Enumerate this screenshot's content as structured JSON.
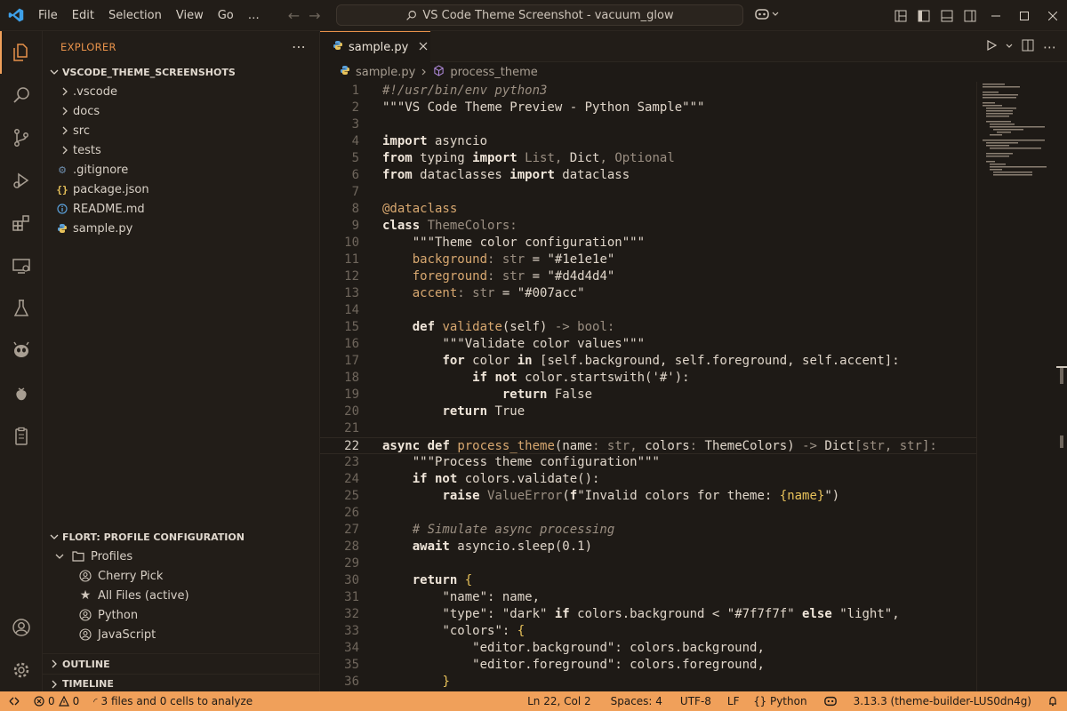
{
  "titlebar": {
    "menus": [
      "File",
      "Edit",
      "Selection",
      "View",
      "Go",
      "…"
    ],
    "search": "VS Code Theme Screenshot - vacuum_glow"
  },
  "sidebar": {
    "title": "EXPLORER",
    "workspace": "VSCODE_THEME_SCREENSHOTS",
    "folders": [
      ".vscode",
      "docs",
      "src",
      "tests"
    ],
    "files": [
      {
        "name": ".gitignore",
        "icon": "gear-file-icon"
      },
      {
        "name": "package.json",
        "icon": "json-icon"
      },
      {
        "name": "README.md",
        "icon": "info-icon"
      },
      {
        "name": "sample.py",
        "icon": "python-icon"
      }
    ],
    "profile_section": "FLORT: PROFILE CONFIGURATION",
    "profiles_label": "Profiles",
    "profiles": [
      {
        "name": "Cherry Pick",
        "icon": "account-icon"
      },
      {
        "name": "All Files (active)",
        "icon": "star-icon"
      },
      {
        "name": "Python",
        "icon": "account-icon"
      },
      {
        "name": "JavaScript",
        "icon": "account-icon"
      }
    ],
    "outline": "OUTLINE",
    "timeline": "TIMELINE"
  },
  "editor": {
    "tab": "sample.py",
    "breadcrumb_file": "sample.py",
    "breadcrumb_symbol": "process_theme",
    "current_line": 22,
    "lines": [
      [
        [
          "cm",
          "#!/usr/bin/env python3"
        ]
      ],
      [
        [
          "st",
          "\"\"\"VS Code Theme Preview - Python Sample\"\"\""
        ]
      ],
      [],
      [
        [
          "kw",
          "import"
        ],
        [
          "t",
          " asyncio"
        ]
      ],
      [
        [
          "kw",
          "from"
        ],
        [
          "t",
          " typing "
        ],
        [
          "kw",
          "import"
        ],
        [
          "ty",
          " List"
        ],
        [
          "op",
          ", "
        ],
        [
          "t",
          "Dict"
        ],
        [
          "op",
          ", "
        ],
        [
          "ty",
          "Optional"
        ]
      ],
      [
        [
          "kw",
          "from"
        ],
        [
          "t",
          " dataclasses "
        ],
        [
          "kw",
          "import"
        ],
        [
          "t",
          " dataclass"
        ]
      ],
      [],
      [
        [
          "fn",
          "@dataclass"
        ]
      ],
      [
        [
          "kw",
          "class"
        ],
        [
          "ty",
          " ThemeColors:"
        ]
      ],
      [
        [
          "t",
          "    "
        ],
        [
          "st",
          "\"\"\"Theme color configuration\"\"\""
        ]
      ],
      [
        [
          "t",
          "    "
        ],
        [
          "fn",
          "background"
        ],
        [
          "op",
          ": "
        ],
        [
          "ty",
          "str"
        ],
        [
          "t",
          " = "
        ],
        [
          "st",
          "\"#1e1e1e\""
        ]
      ],
      [
        [
          "t",
          "    "
        ],
        [
          "fn",
          "foreground"
        ],
        [
          "op",
          ": "
        ],
        [
          "ty",
          "str"
        ],
        [
          "t",
          " = "
        ],
        [
          "st",
          "\"#d4d4d4\""
        ]
      ],
      [
        [
          "t",
          "    "
        ],
        [
          "fn",
          "accent"
        ],
        [
          "op",
          ": "
        ],
        [
          "ty",
          "str"
        ],
        [
          "t",
          " = "
        ],
        [
          "st",
          "\"#007acc\""
        ]
      ],
      [],
      [
        [
          "t",
          "    "
        ],
        [
          "kw",
          "def"
        ],
        [
          "fn",
          " validate"
        ],
        [
          "t",
          "(self)"
        ],
        [
          "op",
          " -> "
        ],
        [
          "ty",
          "bool:"
        ]
      ],
      [
        [
          "t",
          "        "
        ],
        [
          "st",
          "\"\"\"Validate color values\"\"\""
        ]
      ],
      [
        [
          "t",
          "        "
        ],
        [
          "kw",
          "for"
        ],
        [
          "t",
          " color "
        ],
        [
          "kw",
          "in"
        ],
        [
          "t",
          " [self.background, self.foreground, self.accent]:"
        ]
      ],
      [
        [
          "t",
          "            "
        ],
        [
          "kw",
          "if not"
        ],
        [
          "t",
          " color.startswith("
        ],
        [
          "st",
          "'#'"
        ],
        [
          "t",
          "):"
        ]
      ],
      [
        [
          "t",
          "                "
        ],
        [
          "kw",
          "return"
        ],
        [
          "t",
          " False"
        ]
      ],
      [
        [
          "t",
          "        "
        ],
        [
          "kw",
          "return"
        ],
        [
          "t",
          " True"
        ]
      ],
      [],
      [
        [
          "kw",
          "async"
        ],
        [
          "t",
          " "
        ],
        [
          "kw",
          "def"
        ],
        [
          "fn",
          " process_theme"
        ],
        [
          "t",
          "(name"
        ],
        [
          "op",
          ": "
        ],
        [
          "ty",
          "str"
        ],
        [
          "op",
          ", "
        ],
        [
          "t",
          "colors"
        ],
        [
          "op",
          ": "
        ],
        [
          "t",
          "ThemeColors)"
        ],
        [
          "op",
          " -> "
        ],
        [
          "t",
          "Dict"
        ],
        [
          "op",
          "["
        ],
        [
          "ty",
          "str"
        ],
        [
          "op",
          ", "
        ],
        [
          "ty",
          "str"
        ],
        [
          "op",
          "]:"
        ]
      ],
      [
        [
          "t",
          "    "
        ],
        [
          "st",
          "\"\"\"Process theme configuration\"\"\""
        ]
      ],
      [
        [
          "t",
          "    "
        ],
        [
          "kw",
          "if not"
        ],
        [
          "t",
          " colors.validate():"
        ]
      ],
      [
        [
          "t",
          "        "
        ],
        [
          "kw",
          "raise"
        ],
        [
          "ty",
          " ValueError"
        ],
        [
          "t",
          "("
        ],
        [
          "kw",
          "f"
        ],
        [
          "st",
          "\"Invalid colors for theme: "
        ],
        [
          "br",
          "{name}"
        ],
        [
          "st",
          "\""
        ],
        [
          "t",
          ")"
        ]
      ],
      [],
      [
        [
          "t",
          "    "
        ],
        [
          "cm",
          "# Simulate async processing"
        ]
      ],
      [
        [
          "t",
          "    "
        ],
        [
          "kw",
          "await"
        ],
        [
          "t",
          " asyncio.sleep(0.1)"
        ]
      ],
      [],
      [
        [
          "t",
          "    "
        ],
        [
          "kw",
          "return"
        ],
        [
          "br",
          " {"
        ]
      ],
      [
        [
          "t",
          "        "
        ],
        [
          "st",
          "\"name\""
        ],
        [
          "t",
          ": name,"
        ]
      ],
      [
        [
          "t",
          "        "
        ],
        [
          "st",
          "\"type\""
        ],
        [
          "t",
          ": "
        ],
        [
          "st",
          "\"dark\""
        ],
        [
          "kw",
          " if"
        ],
        [
          "t",
          " colors.background < "
        ],
        [
          "st",
          "\"#7f7f7f\""
        ],
        [
          "kw",
          " else"
        ],
        [
          "st",
          " \"light\""
        ],
        [
          "t",
          ","
        ]
      ],
      [
        [
          "t",
          "        "
        ],
        [
          "st",
          "\"colors\""
        ],
        [
          "t",
          ": "
        ],
        [
          "br",
          "{"
        ]
      ],
      [
        [
          "t",
          "            "
        ],
        [
          "st",
          "\"editor.background\""
        ],
        [
          "t",
          ": colors.background,"
        ]
      ],
      [
        [
          "t",
          "            "
        ],
        [
          "st",
          "\"editor.foreground\""
        ],
        [
          "t",
          ": colors.foreground,"
        ]
      ],
      [
        [
          "t",
          "        "
        ],
        [
          "br",
          "}"
        ]
      ]
    ]
  },
  "statusbar": {
    "errors": "0",
    "warnings": "0",
    "analyze": "3 files and 0 cells to analyze",
    "position": "Ln 22, Col 2",
    "spaces": "Spaces: 4",
    "encoding": "UTF-8",
    "eol": "LF",
    "language": "Python",
    "interpreter": "3.13.3 (theme-builder-LUS0dn4g)"
  },
  "colors": {
    "accent": "#f0a05a",
    "background": "#1e1a16",
    "sidebar": "#221d18"
  }
}
